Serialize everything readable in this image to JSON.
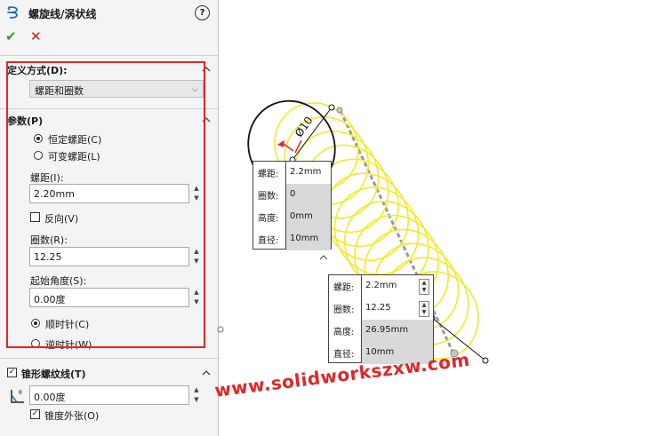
{
  "panel": {
    "title": "螺旋线/涡状线",
    "help_icon": "?",
    "ok_icon": "✔",
    "cancel_icon": "✕",
    "define_by": {
      "header": "定义方式(D):",
      "selected": "螺距和圈数"
    },
    "params": {
      "header": "参数(P)",
      "radio_constant": "恒定螺距(C)",
      "radio_variable": "可变螺距(L)",
      "selected_mode": "constant",
      "pitch_label": "螺距(I):",
      "pitch_value": "2.20mm",
      "reverse_label": "反向(V)",
      "reverse_checked": false,
      "revolutions_label": "圈数(R):",
      "revolutions_value": "12.25",
      "start_angle_label": "起始角度(S):",
      "start_angle_value": "0.00度",
      "radio_clockwise": "顺时针(C)",
      "radio_counterclockwise": "逆时针(W)",
      "selected_direction": "clockwise"
    },
    "taper": {
      "header": "锥形螺纹线(T)",
      "checked": true,
      "angle_value": "0.00度",
      "taper_outward_label": "锥度外张(O)",
      "taper_outward_checked": true
    }
  },
  "viewport": {
    "dimension_label": "Ø10",
    "callout_start": {
      "rows": [
        {
          "key": "螺距:",
          "value": "2.2mm"
        },
        {
          "key": "圈数:",
          "value": "0"
        },
        {
          "key": "高度:",
          "value": "0mm"
        },
        {
          "key": "直径:",
          "value": "10mm"
        }
      ]
    },
    "callout_end": {
      "rows": [
        {
          "key": "螺距:",
          "value": "2.2mm"
        },
        {
          "key": "圈数:",
          "value": "12.25"
        },
        {
          "key": "高度:",
          "value": "26.95mm"
        },
        {
          "key": "直径:",
          "value": "10mm"
        }
      ]
    },
    "watermark": "www.solidworkszxw.com",
    "helix_color": "#f2ea2a"
  }
}
